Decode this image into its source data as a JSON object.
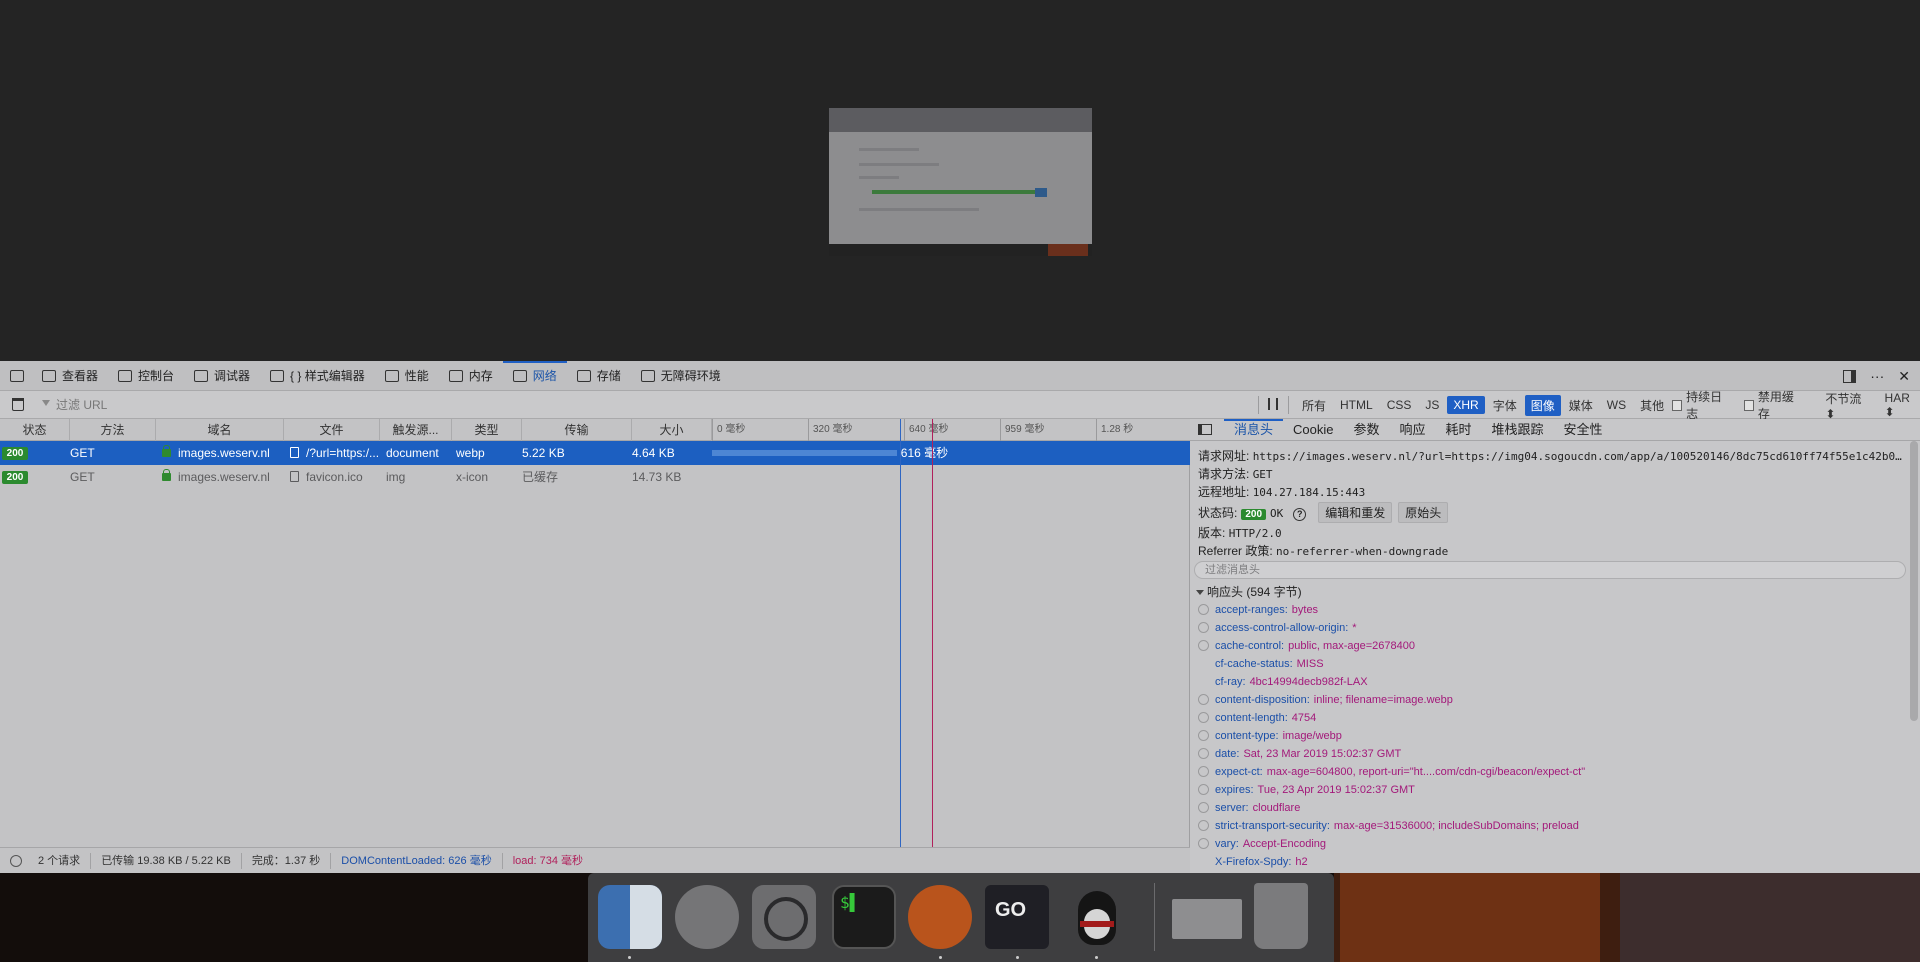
{
  "toolbar": {
    "tabs": [
      {
        "label": "查看器",
        "icon": "inspector-icon"
      },
      {
        "label": "控制台",
        "icon": "console-icon"
      },
      {
        "label": "调试器",
        "icon": "debugger-icon"
      },
      {
        "label": "{ } 样式编辑器",
        "icon": "style-editor-icon"
      },
      {
        "label": "性能",
        "icon": "performance-icon"
      },
      {
        "label": "内存",
        "icon": "memory-icon"
      },
      {
        "label": "网络",
        "icon": "network-icon"
      },
      {
        "label": "存储",
        "icon": "storage-icon"
      },
      {
        "label": "无障碍环境",
        "icon": "accessibility-icon"
      }
    ],
    "active_tab": "网络",
    "right_icons": [
      "dock-side-icon",
      "more-icon",
      "close-icon"
    ],
    "more_label": "···",
    "close_label": "✕"
  },
  "filterbar": {
    "placeholder": "过滤 URL",
    "type_filters": [
      "所有",
      "HTML",
      "CSS",
      "JS",
      "XHR",
      "字体",
      "图像",
      "媒体",
      "WS",
      "其他"
    ],
    "active_filters": [
      "XHR",
      "图像"
    ],
    "persist_log": "持续日志",
    "disable_cache": "禁用缓存",
    "throttle": "不节流 ⬍",
    "har": "HAR ⬍"
  },
  "table": {
    "headers": [
      "状态",
      "方法",
      "域名",
      "文件",
      "触发源...",
      "类型",
      "传输",
      "大小"
    ],
    "timeline_ticks": [
      "0 毫秒",
      "320 毫秒",
      "640 毫秒",
      "959 毫秒",
      "1.28 秒"
    ],
    "rows": [
      {
        "status": "200",
        "method": "GET",
        "domain": "images.weserv.nl",
        "file": "/?url=https:/...",
        "cause": "document",
        "type": "webp",
        "transferred": "5.22 KB",
        "size": "4.64 KB",
        "timing": "616 毫秒",
        "timing_ms": 616,
        "selected": true
      },
      {
        "status": "200",
        "method": "GET",
        "domain": "images.weserv.nl",
        "file": "favicon.ico",
        "cause": "img",
        "type": "x-icon",
        "transferred": "已缓存",
        "size": "14.73 KB",
        "timing": "",
        "selected": false
      }
    ],
    "dom_content_loaded_ms": 626,
    "load_ms": 734
  },
  "statusbar": {
    "requests": "2 个请求",
    "transferred": "已传输 19.38 KB / 5.22 KB",
    "finish": "完成：1.37 秒",
    "dom_loaded": "DOMContentLoaded: 626 毫秒",
    "load": "load: 734 毫秒",
    "colors": {
      "dom_loaded": "#1b4fa8",
      "load": "#b0205b"
    }
  },
  "details": {
    "tabs": [
      "消息头",
      "Cookie",
      "参数",
      "响应",
      "耗时",
      "堆栈跟踪",
      "安全性"
    ],
    "active_tab": "消息头",
    "request_url_label": "请求网址:",
    "request_url": "https://images.weserv.nl/?url=https://img04.sogoucdn.com/app/a/100520146/8dc75cd610ff74f55e1c42b0…",
    "method_label": "请求方法:",
    "method": "GET",
    "remote_label": "远程地址:",
    "remote": "104.27.184.15:443",
    "status_label": "状态码:",
    "status_code": "200",
    "status_text": "OK",
    "edit_resend": "编辑和重发",
    "raw_headers": "原始头",
    "version_label": "版本:",
    "version": "HTTP/2.0",
    "referrer_label": "Referrer 政策:",
    "referrer": "no-referrer-when-downgrade",
    "filter_placeholder": "过滤消息头",
    "response_section": "响应头 (594 字节)",
    "response_headers": [
      {
        "name": "accept-ranges:",
        "value": "bytes",
        "help": true
      },
      {
        "name": "access-control-allow-origin:",
        "value": "*",
        "help": true
      },
      {
        "name": "cache-control:",
        "value": "public, max-age=2678400",
        "help": true
      },
      {
        "name": "cf-cache-status:",
        "value": "MISS",
        "help": false
      },
      {
        "name": "cf-ray:",
        "value": "4bc14994decb982f-LAX",
        "help": false
      },
      {
        "name": "content-disposition:",
        "value": "inline; filename=image.webp",
        "help": true
      },
      {
        "name": "content-length:",
        "value": "4754",
        "help": true
      },
      {
        "name": "content-type:",
        "value": "image/webp",
        "help": true
      },
      {
        "name": "date:",
        "value": "Sat, 23 Mar 2019 15:02:37 GMT",
        "help": true
      },
      {
        "name": "expect-ct:",
        "value": "max-age=604800, report-uri=\"ht....com/cdn-cgi/beacon/expect-ct\"",
        "help": true
      },
      {
        "name": "expires:",
        "value": "Tue, 23 Apr 2019 15:02:37 GMT",
        "help": true
      },
      {
        "name": "server:",
        "value": "cloudflare",
        "help": true
      },
      {
        "name": "strict-transport-security:",
        "value": "max-age=31536000; includeSubDomains; preload",
        "help": true
      },
      {
        "name": "vary:",
        "value": "Accept-Encoding",
        "help": true
      },
      {
        "name": "X-Firefox-Spdy:",
        "value": "h2",
        "help": false
      }
    ]
  },
  "dock": {
    "apps": [
      "finder-icon",
      "launchpad-icon",
      "system-preferences-icon",
      "terminal-icon",
      "firefox-icon",
      "goland-icon",
      "qq-icon",
      "window-thumbnail-icon",
      "trash-icon"
    ],
    "terminal_glyph": "$▌",
    "goland_glyph": "GO"
  }
}
